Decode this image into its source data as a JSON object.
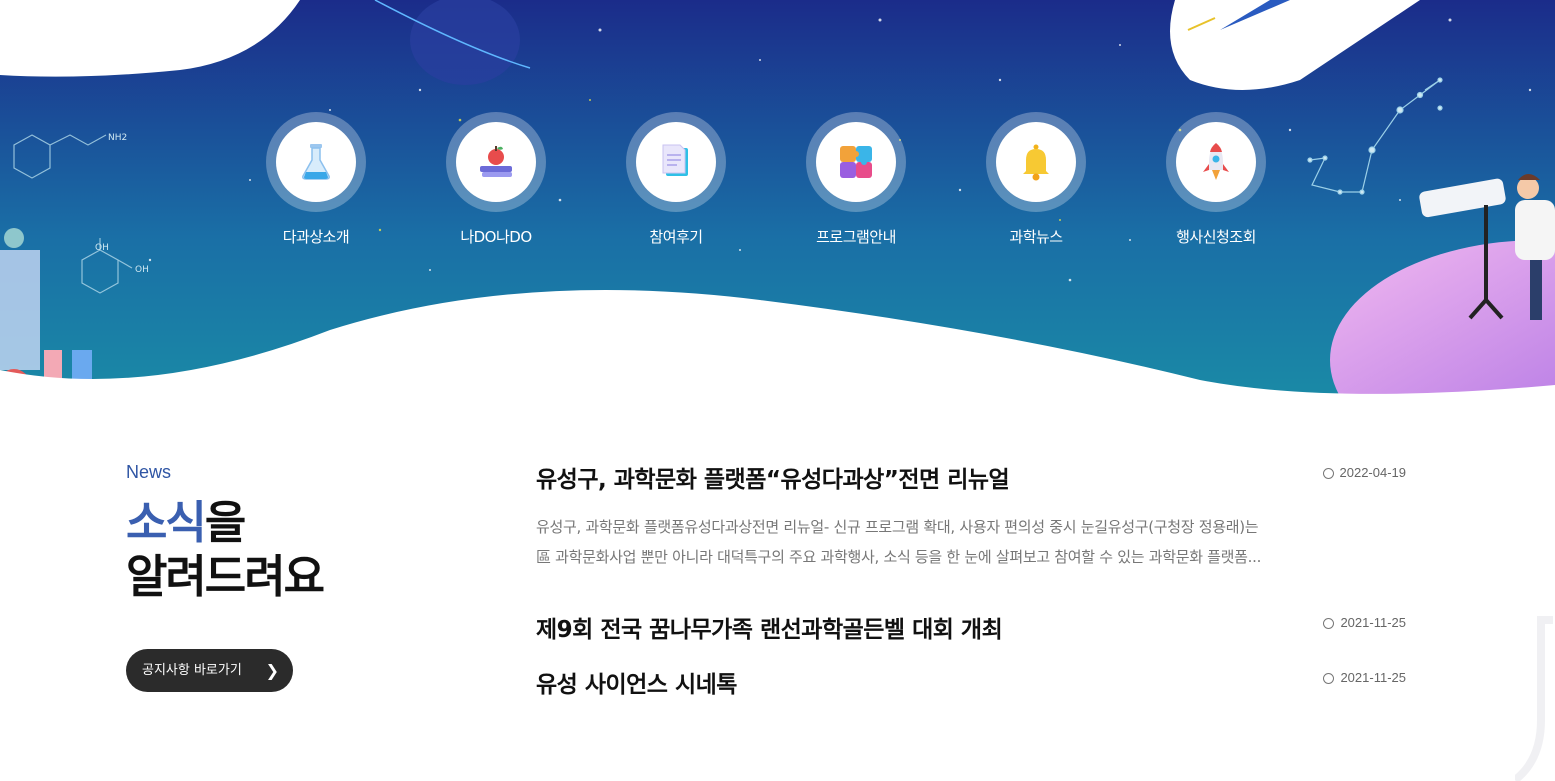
{
  "colors": {
    "accent": "#3a5fb0",
    "dark_button": "#2b2b2b",
    "hero_top": "#1b2c8a",
    "hero_bottom": "#1a8fa6"
  },
  "quick_menu": [
    {
      "label": "다과상소개",
      "icon": "flask-icon"
    },
    {
      "label": "나DO나DO",
      "icon": "book-apple-icon"
    },
    {
      "label": "참여후기",
      "icon": "document-icon"
    },
    {
      "label": "프로그램안내",
      "icon": "puzzle-icon"
    },
    {
      "label": "과학뉴스",
      "icon": "bell-icon"
    },
    {
      "label": "행사신청조회",
      "icon": "rocket-icon"
    }
  ],
  "hero_decor": {
    "molecule_label_1": "NH2",
    "molecule_label_2": "OH",
    "molecule_label_3": "OH"
  },
  "news": {
    "eyebrow": "News",
    "title_highlight": "소식",
    "title_rest_1": "을",
    "title_line_2": "알려드려요",
    "button_label": "공지사항 바로가기",
    "items": [
      {
        "title": "유성구, 과학문화 플랫폼“유성다과상”전면 리뉴얼",
        "date": "2022-04-19",
        "summary_1": "유성구, 과학문화 플랫폼유성다과상전면 리뉴얼- 신규 프로그램 확대, 사용자 편의성 중시 눈길유성구(구청장 정용래)는",
        "summary_2": "區 과학문화사업 뿐만 아니라 대덕특구의 주요 과학행사, 소식 등을 한 눈에 살펴보고 참여할 수 있는 과학문화 플랫폼..."
      },
      {
        "title": "제9회 전국 꿈나무가족 랜선과학골든벨 대회 개최",
        "date": "2021-11-25"
      },
      {
        "title": "유성 사이언스 시네톡",
        "date": "2021-11-25"
      }
    ]
  }
}
